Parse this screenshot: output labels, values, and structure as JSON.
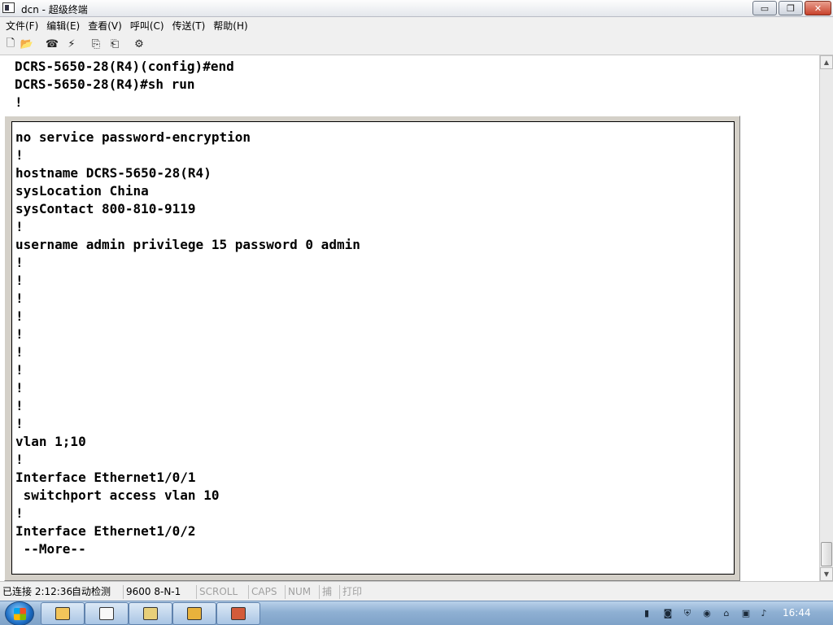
{
  "window": {
    "title": "dcn - 超级终端",
    "minimize_glyph": "▭",
    "maximize_glyph": "❐",
    "close_glyph": "✕"
  },
  "menu": [
    "文件(F)",
    "编辑(E)",
    "查看(V)",
    "呼叫(C)",
    "传送(T)",
    "帮助(H)"
  ],
  "toolbar": [
    {
      "name": "new-icon",
      "glyph": "🗋"
    },
    {
      "name": "open-icon",
      "glyph": "📂"
    },
    {
      "name": "call-icon",
      "glyph": "☎"
    },
    {
      "name": "disconnect-icon",
      "glyph": "⚡"
    },
    {
      "name": "send-icon",
      "glyph": "⎘"
    },
    {
      "name": "receive-icon",
      "glyph": "⎗"
    },
    {
      "name": "properties-icon",
      "glyph": "⚙"
    }
  ],
  "terminal": {
    "background_lines": [
      "DCRS-5650-28(R4)(config)#end",
      "DCRS-5650-28(R4)#sh run",
      "!"
    ],
    "inner_lines": [
      "no service password-encryption",
      "!",
      "hostname DCRS-5650-28(R4)",
      "sysLocation China",
      "sysContact 800-810-9119",
      "!",
      "username admin privilege 15 password 0 admin",
      "!",
      "!",
      "!",
      "!",
      "!",
      "!",
      "!",
      "!",
      "!",
      "!",
      "vlan 1;10",
      "!",
      "Interface Ethernet1/0/1",
      " switchport access vlan 10",
      "!",
      "Interface Ethernet1/0/2",
      " --More--"
    ]
  },
  "scrollbar": {
    "up_glyph": "▲",
    "down_glyph": "▼"
  },
  "status": {
    "connection": "已连接 2:12:36",
    "detect": "自动检测",
    "baud": "9600 8-N-1",
    "scroll": "SCROLL",
    "caps": "CAPS",
    "num": "NUM",
    "capture": "捕",
    "print": "打印"
  },
  "taskbar": {
    "clock": "16:44",
    "colors": {
      "accent": "#1b6bc2",
      "taskbar": "#8fb0d3"
    }
  }
}
